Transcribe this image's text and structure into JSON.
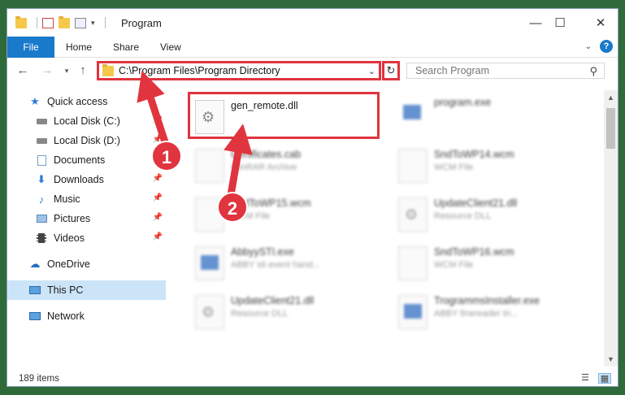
{
  "window": {
    "title": "Program",
    "controls": {
      "minimize": "—",
      "maximize": "☐",
      "close": "✕"
    }
  },
  "ribbon": {
    "tabs": [
      "File",
      "Home",
      "Share",
      "View"
    ],
    "help": "?"
  },
  "nav": {
    "address": "C:\\Program Files\\Program Directory",
    "search_placeholder": "Search Program"
  },
  "sidebar": {
    "items": [
      {
        "label": "Quick access",
        "icon": "star-icon",
        "color": "#2f7bd8"
      },
      {
        "label": "Local Disk (C:)",
        "icon": "drive-icon",
        "pinned": true
      },
      {
        "label": "Local Disk (D:)",
        "icon": "drive-icon",
        "pinned": true
      },
      {
        "label": "Documents",
        "icon": "documents-icon",
        "pinned": true
      },
      {
        "label": "Downloads",
        "icon": "download-icon",
        "pinned": true
      },
      {
        "label": "Music",
        "icon": "music-icon",
        "pinned": true
      },
      {
        "label": "Pictures",
        "icon": "pictures-icon",
        "pinned": true
      },
      {
        "label": "Videos",
        "icon": "videos-icon",
        "pinned": true
      },
      {
        "label": "OneDrive",
        "icon": "cloud-icon"
      },
      {
        "label": "This PC",
        "icon": "computer-icon",
        "selected": true
      },
      {
        "label": "Network",
        "icon": "network-icon"
      }
    ]
  },
  "files": [
    {
      "name": "gen_remote.dll",
      "type": "",
      "icon": "gear-file-icon",
      "highlighted": true
    },
    {
      "name": "program.exe",
      "type": "",
      "icon": "exe-icon"
    },
    {
      "name": "Certificates.cab",
      "type": "WinRAR Archive",
      "icon": "rar-icon"
    },
    {
      "name": "SndToWP14.wcm",
      "type": "WCM File",
      "icon": "file-icon"
    },
    {
      "name": "SndToWP15.wcm",
      "type": "WCM File",
      "icon": "file-icon"
    },
    {
      "name": "UpdateClient21.dll",
      "type": "Resource DLL",
      "icon": "gear-file-icon"
    },
    {
      "name": "AbbyySTI.exe",
      "type": "ABBY sti event hand...",
      "icon": "exe-icon"
    },
    {
      "name": "SndToWP16.wcm",
      "type": "WCM File",
      "icon": "file-icon"
    },
    {
      "name": "UpdateClient21.dll",
      "type": "Resource DLL",
      "icon": "gear-file-icon"
    },
    {
      "name": "TrogrammsInstaller.exe",
      "type": "ABBY finereader tri...",
      "icon": "exe-icon"
    }
  ],
  "status": {
    "items": "189 items"
  },
  "callouts": [
    "1",
    "2"
  ],
  "colors": {
    "accent": "#1979ca",
    "highlight": "#e0343f",
    "selected": "#cce4f7"
  }
}
